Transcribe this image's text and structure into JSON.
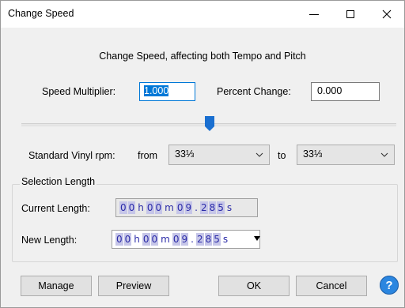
{
  "window": {
    "title": "Change Speed"
  },
  "heading": "Change Speed, affecting both Tempo and Pitch",
  "speed": {
    "label": "Speed Multiplier:",
    "value": "1.000"
  },
  "percent": {
    "label": "Percent Change:",
    "value": "0.000"
  },
  "slider": {
    "level_fraction": 0.5
  },
  "vinyl": {
    "label": "Standard Vinyl rpm:",
    "from_label": "from",
    "from_value": "33⅓",
    "to_label": "to",
    "to_value": "33⅓"
  },
  "selection": {
    "title": "Selection Length",
    "current_label": "Current Length:",
    "new_label": "New Length:",
    "current_parts": [
      "0",
      "0",
      "h",
      "0",
      "0",
      "m",
      "0",
      "9",
      ".",
      "2",
      "8",
      "5",
      "s"
    ],
    "new_parts": [
      "0",
      "0",
      "h",
      "0",
      "0",
      "m",
      "0",
      "9",
      ".",
      "2",
      "8",
      "5",
      "s"
    ]
  },
  "buttons": {
    "manage": "Manage",
    "preview": "Preview",
    "ok": "OK",
    "cancel": "Cancel",
    "help": "?"
  },
  "colors": {
    "accent": "#0078d7",
    "slider_thumb": "#1a6fd0",
    "help": "#2b86e0",
    "time_digits": "#2b2ba8"
  }
}
